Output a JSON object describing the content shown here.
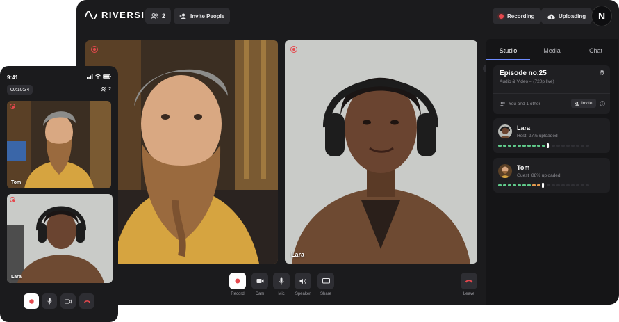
{
  "app": {
    "brand": "RIVERSIDE"
  },
  "topbar": {
    "participants_count": "2",
    "invite_label": "Invite People",
    "recording_label": "Recording",
    "uploading_label": "Uploading",
    "user_initial": "N"
  },
  "stage": {
    "tiles": [
      {
        "name": ""
      },
      {
        "name": "Lara"
      }
    ]
  },
  "controls": {
    "record": "Record",
    "cam": "Cam",
    "mic": "Mic",
    "speaker": "Speaker",
    "share": "Share",
    "leave": "Leave"
  },
  "sidebar": {
    "tabs": [
      "Studio",
      "Media",
      "Chat"
    ],
    "active_tab": "Studio",
    "episode": {
      "title": "Episode no.25",
      "subtitle": "Audio & Video – (720p live)",
      "participants_text": "You and 1 other",
      "invite_label": "Invite"
    },
    "people": [
      {
        "name": "Lara",
        "role": "Host",
        "upload_text": "97% uploaded",
        "upload_fraction": 0.97
      },
      {
        "name": "Tom",
        "role": "Guest",
        "upload_text": "88% uploaded",
        "upload_fraction": 0.88
      }
    ]
  },
  "phone": {
    "clock": "9:41",
    "timer": "00:10:34",
    "participants_count": "2",
    "tiles": [
      {
        "name": "Tom"
      },
      {
        "name": "Lara"
      }
    ]
  },
  "colors": {
    "accent_red": "#e5484d",
    "progress_green": "#5fc98a",
    "progress_orange": "#e39a4f",
    "tab_underline": "#6e8cff"
  }
}
